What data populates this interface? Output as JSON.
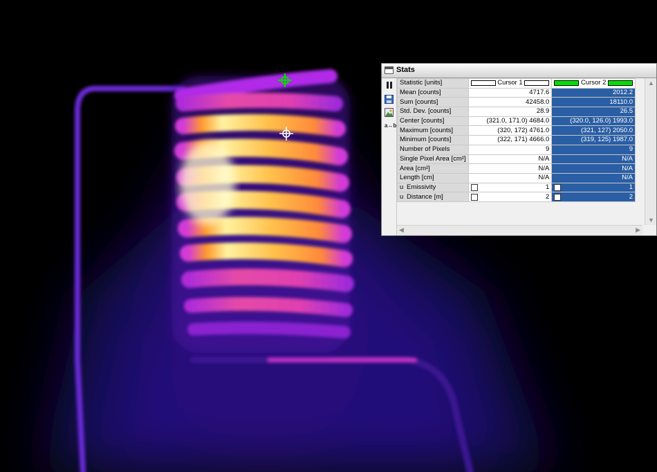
{
  "stats_window": {
    "title": "Stats",
    "header": {
      "label": "Statistic [units]",
      "cursor1": "Cursor 1",
      "cursor2": "Cursor 2"
    },
    "rows": [
      {
        "label": "Mean [counts]",
        "c1": "4717.6",
        "c2": "2012.2"
      },
      {
        "label": "Sum [counts]",
        "c1": "42458.0",
        "c2": "18110.0"
      },
      {
        "label": "Std. Dev. [counts]",
        "c1": "28.9",
        "c2": "26.5"
      },
      {
        "label": "Center [counts]",
        "c1": "(321.0, 171.0) 4684.0",
        "c2": "(320.0, 126.0) 1993.0"
      },
      {
        "label": "Maximum [counts]",
        "c1": "(320, 172) 4761.0",
        "c2": "(321, 127) 2050.0"
      },
      {
        "label": "Minimum [counts]",
        "c1": "(322, 171) 4666.0",
        "c2": "(319, 125) 1987.0"
      },
      {
        "label": "Number of Pixels",
        "c1": "9",
        "c2": "9"
      },
      {
        "label": "Single Pixel Area [cm²]",
        "c1": "N/A",
        "c2": "N/A"
      },
      {
        "label": "Area [cm²]",
        "c1": "N/A",
        "c2": "N/A"
      },
      {
        "label": "Length [cm]",
        "c1": "N/A",
        "c2": "N/A"
      }
    ],
    "param_rows": [
      {
        "flag": "u",
        "label": "Emissivity",
        "c1": "1",
        "c2": "1"
      },
      {
        "flag": "u",
        "label": "Distance [m]",
        "c1": "2",
        "c2": "2"
      }
    ],
    "toolbar": {
      "ab_label": "a↔b"
    },
    "scroll": {
      "up": "▲",
      "down": "▼",
      "left": "◀",
      "right": "▶"
    }
  },
  "colors": {
    "cursor1": "#ffffff",
    "cursor2": "#00e000",
    "selected_col": "#2a5ea5"
  },
  "icons": [
    "pause-icon",
    "save-icon",
    "image-icon",
    "ab-icon",
    "crosshair-icon"
  ]
}
